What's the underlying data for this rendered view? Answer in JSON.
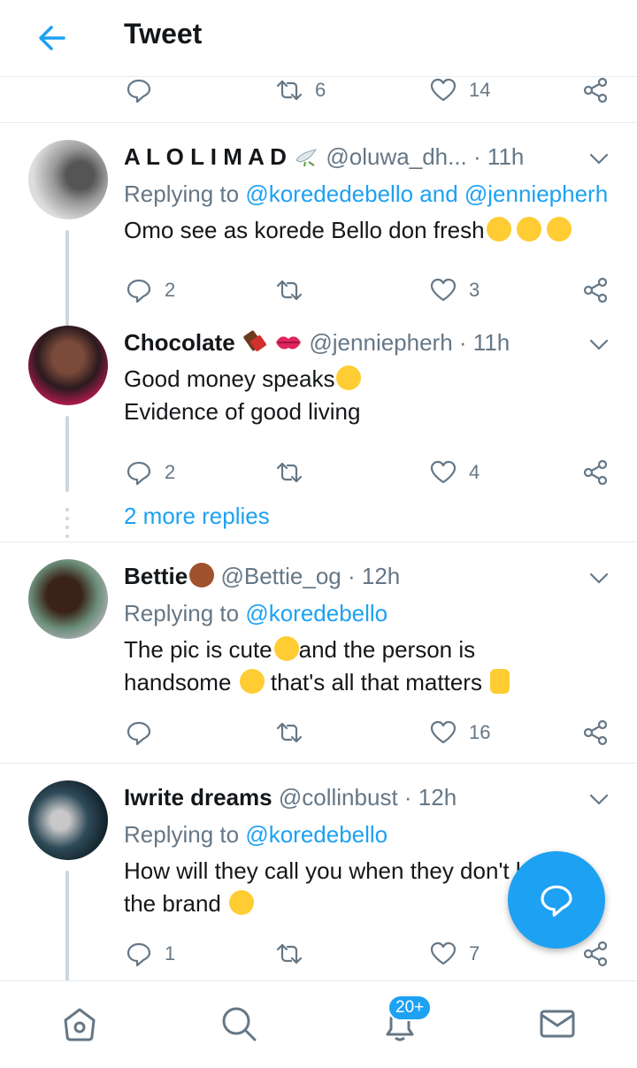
{
  "header": {
    "title": "Tweet"
  },
  "top_actions": {
    "retweets": "6",
    "likes": "14"
  },
  "tweets": [
    {
      "name": "A L O L I M A D",
      "handle": "@oluwa_dh...",
      "time": "· 11h",
      "replying_prefix": "Replying to",
      "replying_to": "@korededebello and @jenniepherh",
      "lines": [
        "Omo see as korede Bello don fresh"
      ],
      "replies": "2",
      "retweets": "",
      "likes": "3"
    },
    {
      "name": "Chocolate",
      "handle": "@jenniepherh",
      "time": "· 11h",
      "lines": [
        "Good money speaks",
        "Evidence of good living"
      ],
      "replies": "2",
      "retweets": "",
      "likes": "4"
    },
    {
      "name": "Bettie",
      "handle": "@Bettie_og",
      "time": "· 12h",
      "replying_prefix": "Replying to",
      "replying_to": "@koredebello",
      "lines": [
        "The pic is cute",
        "and the person is",
        "handsome",
        "that's all that matters"
      ],
      "replies": "",
      "retweets": "",
      "likes": "16"
    },
    {
      "name": "Iwrite dreams",
      "handle": "@collinbust",
      "time": "· 12h",
      "replying_prefix": "Replying to",
      "replying_to": "@koredebello",
      "lines": [
        "How will they call you when they don't know",
        "the brand"
      ],
      "replies": "1",
      "retweets": "",
      "likes": "7"
    }
  ],
  "more_replies": "2 more replies",
  "bottom_nav": {
    "badge": "20+"
  },
  "icons": [
    "back-arrow-icon",
    "reply-icon",
    "retweet-icon",
    "like-icon",
    "share-icon",
    "chevron-down-icon",
    "home-icon",
    "search-icon",
    "notifications-icon",
    "messages-icon",
    "compose-reply-icon"
  ],
  "colors": {
    "accent": "#1da1f2",
    "muted": "#657786",
    "divider": "#e6ecf0"
  }
}
